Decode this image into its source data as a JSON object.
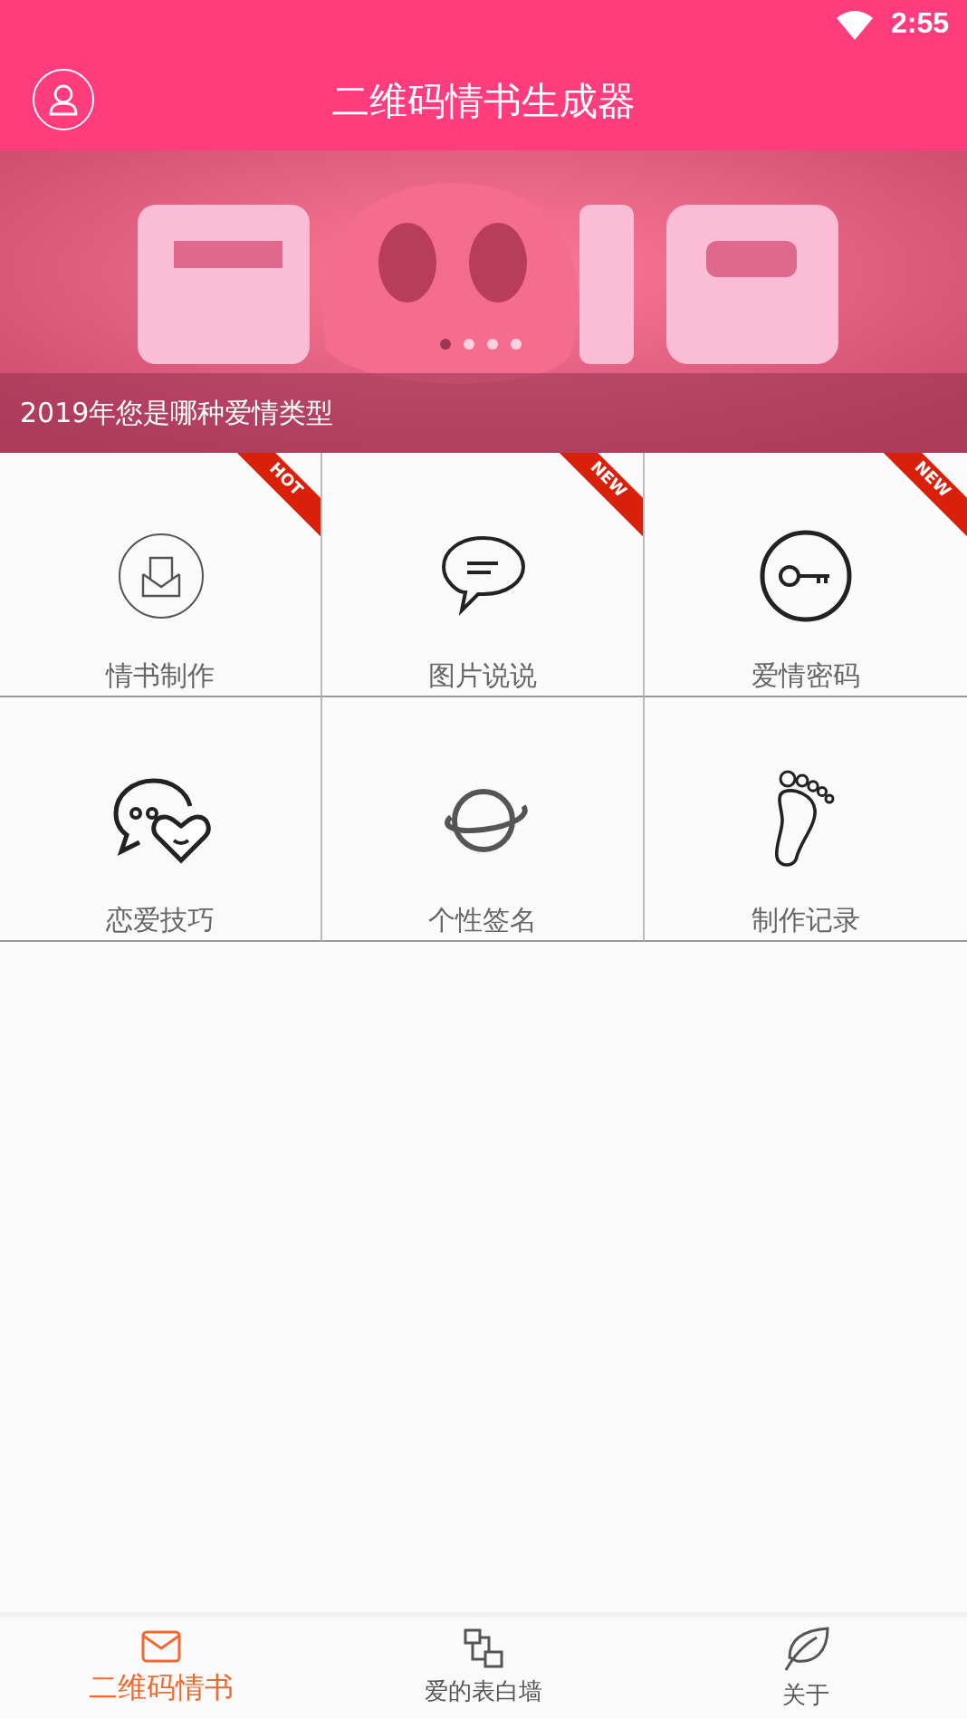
{
  "status_bar": {
    "time": "2:55"
  },
  "header": {
    "title": "二维码情书生成器"
  },
  "banner": {
    "caption": "2019年您是哪种爱情类型",
    "dots": [
      {
        "selected": true
      },
      {
        "selected": false
      },
      {
        "selected": false
      },
      {
        "selected": false
      }
    ]
  },
  "grid": [
    {
      "label": "情书制作",
      "badge": "HOT"
    },
    {
      "label": "图片说说",
      "badge": "NEW"
    },
    {
      "label": "爱情密码",
      "badge": "NEW"
    },
    {
      "label": "恋爱技巧"
    },
    {
      "label": "个性签名"
    },
    {
      "label": "制作记录"
    }
  ],
  "bottom_nav": [
    {
      "label": "二维码情书",
      "selected": true
    },
    {
      "label": "爱的表白墙",
      "selected": false
    },
    {
      "label": "关于",
      "selected": false
    }
  ]
}
